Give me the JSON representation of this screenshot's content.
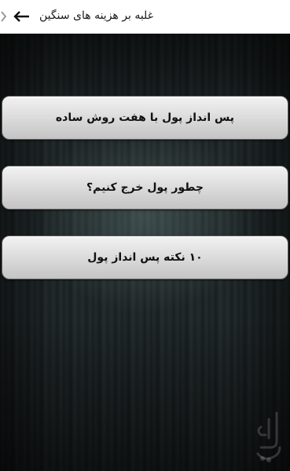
{
  "appbar": {
    "title": "غلبه بر هزینه های سنگین",
    "back_icon": "arrow-left-icon",
    "chevron_icon": "chevron-right-icon",
    "background": "#ffffff"
  },
  "menu": {
    "items": [
      {
        "label": "پس انداز پول با هفت روش ساده"
      },
      {
        "label": "چطور پول خرج کنیم؟"
      },
      {
        "label": "۱۰ نکته پس انداز پول"
      }
    ]
  },
  "watermark": {
    "label": "بازار",
    "icon": "bazaar-logo-icon"
  },
  "colors": {
    "button_face": "#e0e0e0",
    "button_text": "#111111",
    "background": "#1c2223"
  }
}
